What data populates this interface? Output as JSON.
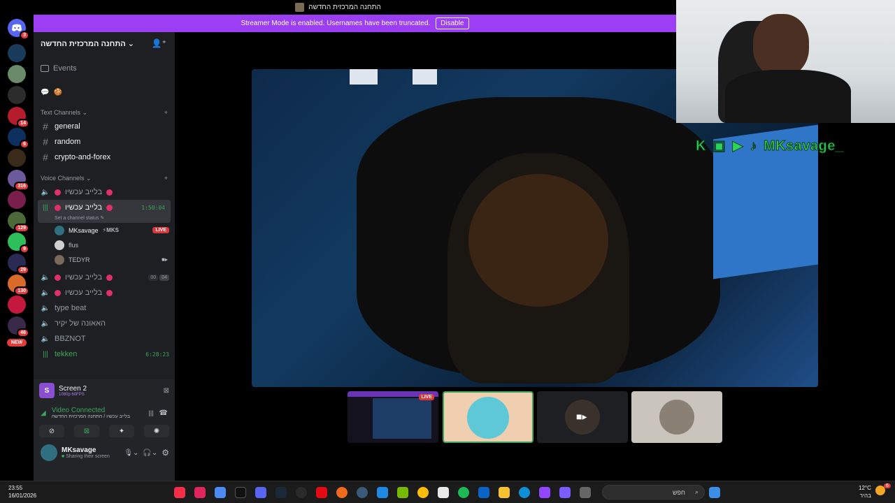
{
  "window": {
    "title": "התחנה המרכזית החדשה"
  },
  "banner": {
    "text": "Streamer Mode is enabled. Usernames have been truncated.",
    "button": "Disable"
  },
  "rail": {
    "badges": [
      "3",
      "14",
      "6",
      "316",
      "129",
      "9",
      "29",
      "130",
      "46"
    ],
    "new_label": "NEW"
  },
  "server": {
    "name": "התחנה המרכזית החדשה"
  },
  "nav": {
    "events": "Events"
  },
  "text_channels": {
    "title": "Text Channels",
    "items": [
      "general",
      "random",
      "crypto-and-forex"
    ]
  },
  "voice_channels": {
    "title": "Voice Channels",
    "items": [
      {
        "label": "בלייב עכשיו"
      },
      {
        "label": "בלייב עכשיו",
        "time": "1:50:04",
        "status": "Set a channel status"
      },
      {
        "label": "בלייב עכשיו",
        "counter_a": "00",
        "counter_b": "04"
      },
      {
        "label": "בלייב עכשיו"
      },
      {
        "label": "type beat"
      },
      {
        "label": "האאונה של יקיר"
      },
      {
        "label": "BBZNOT"
      },
      {
        "label": "tekken",
        "time": "6:28:23"
      }
    ],
    "users": [
      {
        "name": "MKsavage",
        "tag": "⚡MKS",
        "live": "LIVE"
      },
      {
        "name": "flus"
      },
      {
        "name": "TEDYR"
      }
    ]
  },
  "screen_share": {
    "title": "Screen 2",
    "quality": "1080p 60FPS"
  },
  "voice_status": {
    "title": "Video Connected",
    "location": "בלייב עכשיו / התחנה המרכזית החדשה"
  },
  "user_panel": {
    "name": "MKsavage",
    "status": "Sharing their screen"
  },
  "stage": {
    "live_label": "LIVE"
  },
  "overlay": {
    "name": "MKsavage_"
  },
  "taskbar": {
    "time": "23:55",
    "date": "16/01/2026",
    "search_placeholder": "חפש",
    "weather_temp": "12°C",
    "weather_label": "בהיר",
    "notif_count": "6"
  },
  "colors": {
    "accent": "#9b3ef4",
    "live": "#da373c",
    "connected": "#3ba55c",
    "badge": "#e23c3c"
  }
}
